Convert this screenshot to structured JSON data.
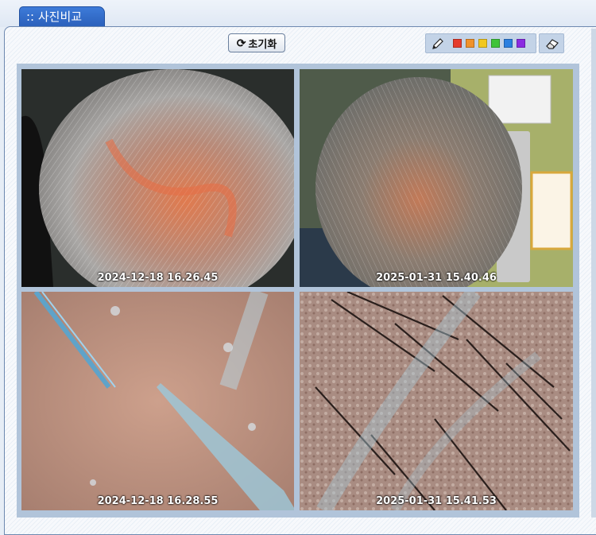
{
  "tab": {
    "label": ":: 사진비교"
  },
  "toolbar": {
    "reset_label": "초기화",
    "reset_icon": "refresh-icon",
    "pen_icon": "pencil-icon",
    "eraser_icon": "eraser-icon",
    "colors": [
      "#e53b2c",
      "#f0922b",
      "#f2c81f",
      "#3ec43a",
      "#2a7fe0",
      "#8b2be2"
    ]
  },
  "photos": [
    {
      "timestamp": "2024-12-18 16.26.45",
      "kind": "scalp-top-view"
    },
    {
      "timestamp": "2025-01-31 15.40.46",
      "kind": "scalp-top-view"
    },
    {
      "timestamp": "2024-12-18 16.28.55",
      "kind": "scalp-microscope"
    },
    {
      "timestamp": "2025-01-31 15.41.53",
      "kind": "scalp-microscope"
    }
  ]
}
